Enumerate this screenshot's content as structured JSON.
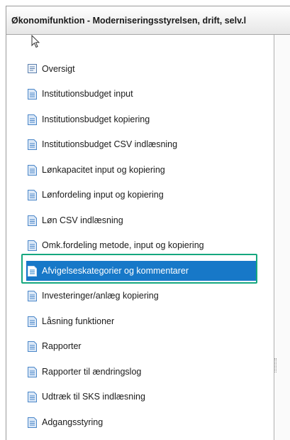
{
  "window": {
    "title": "Økonomifunktion - Moderniseringsstyrelsen, drift, selv.l"
  },
  "menu": {
    "items": [
      {
        "label": "Oversigt",
        "icon": "overview-icon"
      },
      {
        "label": "Institutionsbudget input",
        "icon": "document-icon"
      },
      {
        "label": "Institutionsbudget kopiering",
        "icon": "document-icon"
      },
      {
        "label": "Institutionsbudget CSV indlæsning",
        "icon": "document-icon"
      },
      {
        "label": "Lønkapacitet input og kopiering",
        "icon": "document-icon"
      },
      {
        "label": "Lønfordeling input og kopiering",
        "icon": "document-icon"
      },
      {
        "label": "Løn CSV indlæsning",
        "icon": "document-icon"
      },
      {
        "label": "Omk.fordeling metode, input og kopiering",
        "icon": "document-icon"
      },
      {
        "label": "Afvigelseskategorier og kommentarer",
        "icon": "document-icon",
        "selected": true
      },
      {
        "label": "Investeringer/anlæg kopiering",
        "icon": "document-icon"
      },
      {
        "label": "Låsning funktioner",
        "icon": "document-icon"
      },
      {
        "label": "Rapporter",
        "icon": "document-icon"
      },
      {
        "label": "Rapporter til ændringslog",
        "icon": "document-icon"
      },
      {
        "label": "Udtræk til SKS indlæsning",
        "icon": "document-icon"
      },
      {
        "label": "Adgangsstyring",
        "icon": "document-icon"
      }
    ]
  },
  "colors": {
    "selection": "#1778c8",
    "highlight_border": "#16a77f",
    "doc_icon": "#4a86c8"
  }
}
